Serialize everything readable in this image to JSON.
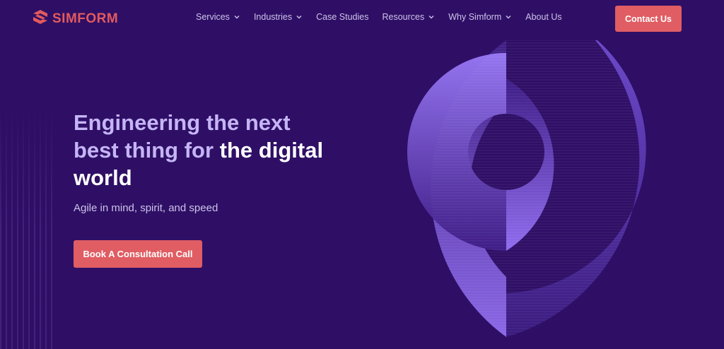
{
  "brand": {
    "name": "SIMFORM",
    "logo_icon": "simform-s-logo-icon",
    "color": "#e25a5e"
  },
  "nav": {
    "items": [
      {
        "label": "Services",
        "has_dropdown": true
      },
      {
        "label": "Industries",
        "has_dropdown": true
      },
      {
        "label": "Case Studies",
        "has_dropdown": false
      },
      {
        "label": "Resources",
        "has_dropdown": true
      },
      {
        "label": "Why Simform",
        "has_dropdown": true
      },
      {
        "label": "About Us",
        "has_dropdown": false
      }
    ],
    "cta_label": "Contact Us"
  },
  "hero": {
    "title_part1": "Engineering the next best thing for",
    "title_highlight": "the digital world",
    "subtitle": "Agile in mind, spirit, and speed",
    "cta_label": "Book A Consultation Call"
  },
  "colors": {
    "background": "#2f0f66",
    "accent": "#e05d63",
    "title": "#c5b5f6",
    "highlight": "#ffffff",
    "graphic_purple": "#8a67e6"
  }
}
